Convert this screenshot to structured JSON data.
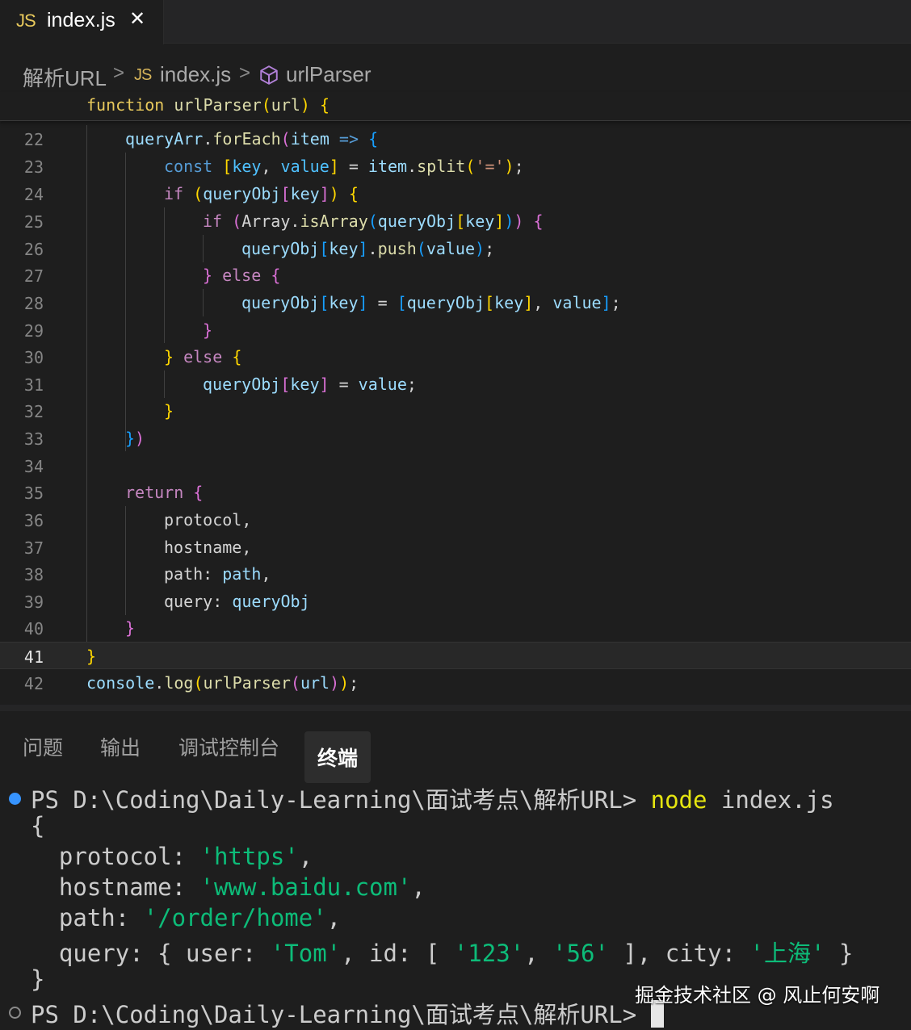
{
  "tab": {
    "icon_label": "JS",
    "filename": "index.js",
    "close_glyph": "✕"
  },
  "breadcrumb": {
    "folder": "解析URL",
    "sep": ">",
    "file_icon": "JS",
    "file": "index.js",
    "symbol_icon": "cube-icon",
    "symbol": "urlParser"
  },
  "sticky": {
    "kw": "function",
    "name": "urlParser",
    "open": "(",
    "param": "url",
    "close": ")",
    "brace": "{"
  },
  "code_lines": [
    {
      "n": "22"
    },
    {
      "n": "23"
    },
    {
      "n": "24"
    },
    {
      "n": "25"
    },
    {
      "n": "26"
    },
    {
      "n": "27"
    },
    {
      "n": "28"
    },
    {
      "n": "29"
    },
    {
      "n": "30"
    },
    {
      "n": "31"
    },
    {
      "n": "32"
    },
    {
      "n": "33"
    },
    {
      "n": "34"
    },
    {
      "n": "35"
    },
    {
      "n": "36"
    },
    {
      "n": "37"
    },
    {
      "n": "38"
    },
    {
      "n": "39"
    },
    {
      "n": "40"
    },
    {
      "n": "41"
    },
    {
      "n": "42"
    }
  ],
  "code": {
    "l22": [
      "queryArr",
      ".",
      "forEach",
      "(",
      "item",
      " => ",
      "{"
    ],
    "l23": [
      "const",
      " ",
      "[",
      "key",
      ", ",
      "value",
      "]",
      " = ",
      "item",
      ".",
      "split",
      "(",
      "'='",
      ")",
      ";"
    ],
    "l24": [
      "if",
      " ",
      "(",
      "queryObj",
      "[",
      "key",
      "]",
      ")",
      " ",
      "{"
    ],
    "l25": [
      "if",
      " ",
      "(",
      "Array",
      ".",
      "isArray",
      "(",
      "queryObj",
      "[",
      "key",
      "]",
      ")",
      ")",
      " ",
      "{"
    ],
    "l26": [
      "queryObj",
      "[",
      "key",
      "]",
      ".",
      "push",
      "(",
      "value",
      ")",
      ";"
    ],
    "l27": [
      "}",
      " ",
      "else",
      " ",
      "{"
    ],
    "l28": [
      "queryObj",
      "[",
      "key",
      "]",
      " = ",
      "[",
      "queryObj",
      "[",
      "key",
      "]",
      ", ",
      "value",
      "]",
      ";"
    ],
    "l29": [
      "}"
    ],
    "l30": [
      "}",
      " ",
      "else",
      " ",
      "{"
    ],
    "l31": [
      "queryObj",
      "[",
      "key",
      "]",
      " = ",
      "value",
      ";"
    ],
    "l32": [
      "}"
    ],
    "l33": [
      "}",
      ")"
    ],
    "l35": [
      "return",
      " ",
      "{"
    ],
    "l36": [
      "protocol",
      ","
    ],
    "l37": [
      "hostname",
      ","
    ],
    "l38": [
      "path",
      ": ",
      "path",
      ","
    ],
    "l39": [
      "query",
      ": ",
      "queryObj"
    ],
    "l40": [
      "}"
    ],
    "l41": [
      "}"
    ],
    "l42": [
      "console",
      ".",
      "log",
      "(",
      "urlParser",
      "(",
      "url",
      ")",
      ")",
      ";"
    ]
  },
  "panel": {
    "tabs": [
      "问题",
      "输出",
      "调试控制台",
      "终端"
    ],
    "active_tab": "终端"
  },
  "terminal": {
    "prompt": "PS D:\\Coding\\Daily-Learning\\面试考点\\解析URL> ",
    "command": "node",
    "arg": " index.js",
    "open_brace": "{",
    "k_protocol": "  protocol: ",
    "v_protocol": "'https'",
    "k_hostname": "  hostname: ",
    "v_hostname": "'www.baidu.com'",
    "k_path": "  path: ",
    "v_path": "'/order/home'",
    "q_pre": "  query: { user: ",
    "q_user": "'Tom'",
    "q_mid": ", id: [ ",
    "q_id1": "'123'",
    "q_comma": ", ",
    "q_id2": "'56'",
    "q_mid2": " ], city: ",
    "q_city": "'上海'",
    "q_end": " }",
    "close_brace": "}",
    "comma": ","
  },
  "watermark": "掘金技术社区 @ 风止何安啊"
}
